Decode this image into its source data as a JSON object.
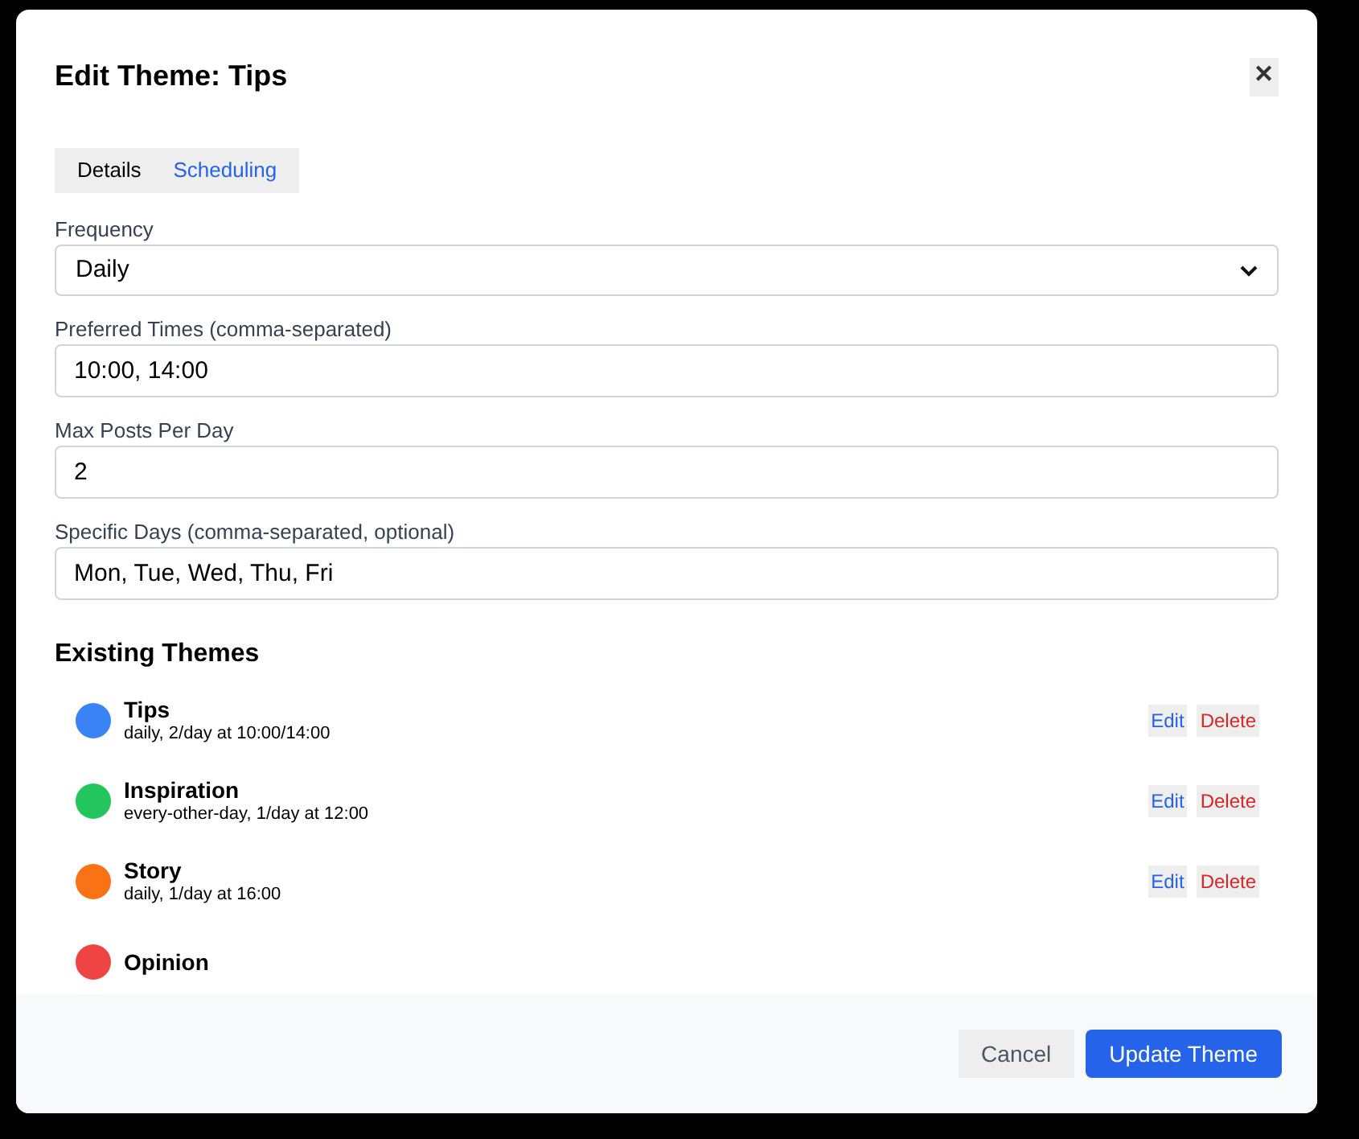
{
  "dialog": {
    "title": "Edit Theme: Tips",
    "close": "✕"
  },
  "tabs": [
    {
      "label": "Details",
      "selected": false
    },
    {
      "label": "Scheduling",
      "selected": true
    }
  ],
  "fields": [
    {
      "kind": "select",
      "label": "Frequency",
      "value": "Daily"
    },
    {
      "kind": "text",
      "label": "Preferred Times (comma-separated)",
      "value": "10:00, 14:00"
    },
    {
      "kind": "text",
      "label": "Max Posts Per Day",
      "value": "2"
    },
    {
      "kind": "text",
      "label": "Specific Days (comma-separated, optional)",
      "value": "Mon, Tue, Wed, Thu, Fri"
    }
  ],
  "existing_themes": {
    "title": "Existing Themes",
    "items": [
      {
        "name": "Tips",
        "summary": "daily, 2/day at 10:00/14:00",
        "color": "#3b82f6",
        "edit": "Edit",
        "delete": "Delete"
      },
      {
        "name": "Inspiration",
        "summary": "every-other-day, 1/day at 12:00",
        "color": "#22c55e",
        "edit": "Edit",
        "delete": "Delete"
      },
      {
        "name": "Story",
        "summary": "daily, 1/day at 16:00",
        "color": "#f97316",
        "edit": "Edit",
        "delete": "Delete"
      },
      {
        "name": "Opinion",
        "color": "#ef4444"
      }
    ]
  },
  "footer": {
    "cancel": "Cancel",
    "submit": "Update Theme"
  }
}
